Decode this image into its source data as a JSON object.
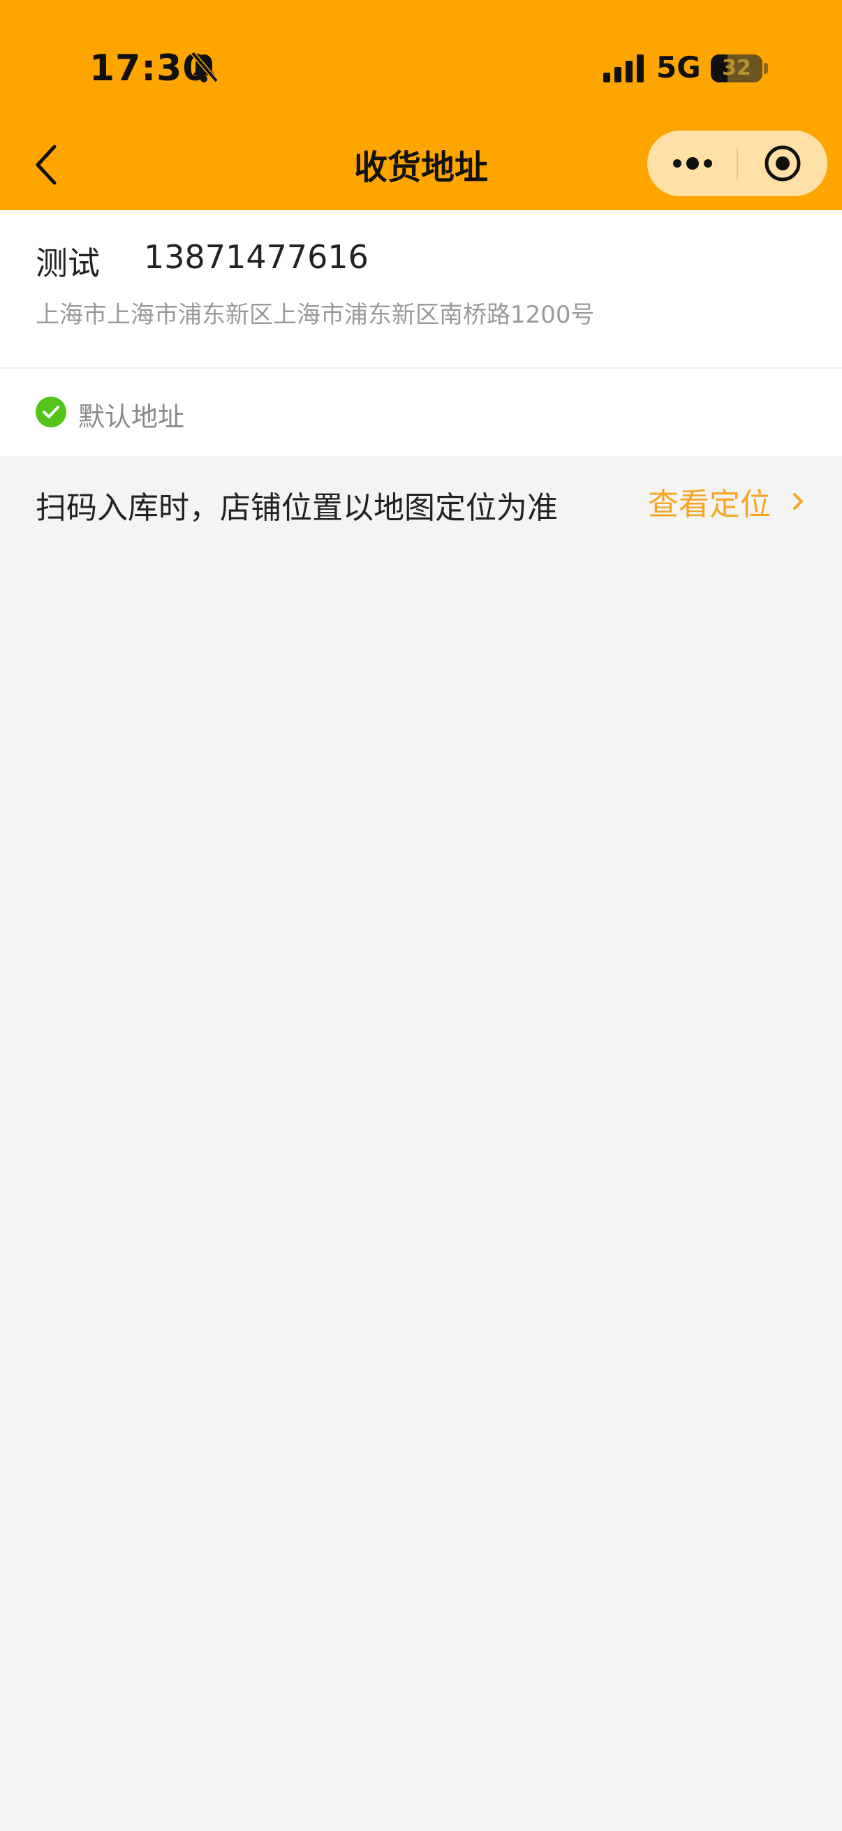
{
  "status_bar": {
    "time": "17:30",
    "network": "5G",
    "battery": "32"
  },
  "nav": {
    "title": "收货地址"
  },
  "address": {
    "name": "测试",
    "phone": "13871477616",
    "detail": "上海市上海市浦东新区上海市浦东新区南桥路1200号"
  },
  "default_label": "默认地址",
  "tip": {
    "text": "扫码入库时，店铺位置以地图定位为准",
    "link_label": "查看定位"
  },
  "colors": {
    "header": "#ffa500",
    "capsule": "#ffe0a6",
    "link": "#f5a623",
    "check": "#52c41a",
    "background": "#f4f4f4"
  },
  "icons": [
    "bell-slash-icon",
    "signal-icon",
    "battery-icon",
    "back-icon",
    "more-icon",
    "close-target-icon",
    "check-circle-icon",
    "chevron-right-icon"
  ]
}
